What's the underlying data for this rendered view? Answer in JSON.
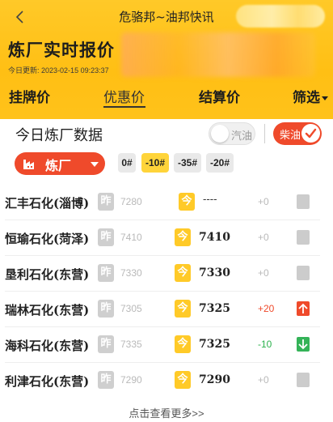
{
  "nav": {
    "title": "危骆邦~油邦快讯"
  },
  "header": {
    "title": "炼厂实时报价",
    "update_label": "今日更新:",
    "update_time": "2023-02-15 09:23:37"
  },
  "tabs": [
    {
      "label": "挂牌价"
    },
    {
      "label": "优惠价"
    },
    {
      "label": "结算价"
    },
    {
      "label": "筛选"
    }
  ],
  "panel": {
    "title": "今日炼厂数据",
    "toggle_gas": "汽油",
    "toggle_diesel": "柴油",
    "factory_label": "炼厂",
    "grades": [
      "0#",
      "-10#",
      "-35#",
      "-20#"
    ],
    "selected_grade": "-10#",
    "yesterday_badge": "昨",
    "today_badge": "今"
  },
  "rows": [
    {
      "name": "汇丰石化(淄博)",
      "yesterday": "7280",
      "today": "----",
      "change": "+0",
      "trend": "none"
    },
    {
      "name": "恒瑜石化(菏泽)",
      "yesterday": "7410",
      "today": "7410",
      "change": "+0",
      "trend": "none"
    },
    {
      "name": "垦利石化(东营)",
      "yesterday": "7330",
      "today": "7330",
      "change": "+0",
      "trend": "none"
    },
    {
      "name": "瑞林石化(东营)",
      "yesterday": "7305",
      "today": "7325",
      "change": "+20",
      "trend": "up"
    },
    {
      "name": "海科石化(东营)",
      "yesterday": "7335",
      "today": "7325",
      "change": "-10",
      "trend": "down"
    },
    {
      "name": "利津石化(东营)",
      "yesterday": "7290",
      "today": "7290",
      "change": "+0",
      "trend": "none"
    }
  ],
  "more_link": "点击查看更多>>",
  "colors": {
    "accent": "#ffc21a",
    "primary_red": "#ef4a2b",
    "down_green": "#34b358"
  }
}
